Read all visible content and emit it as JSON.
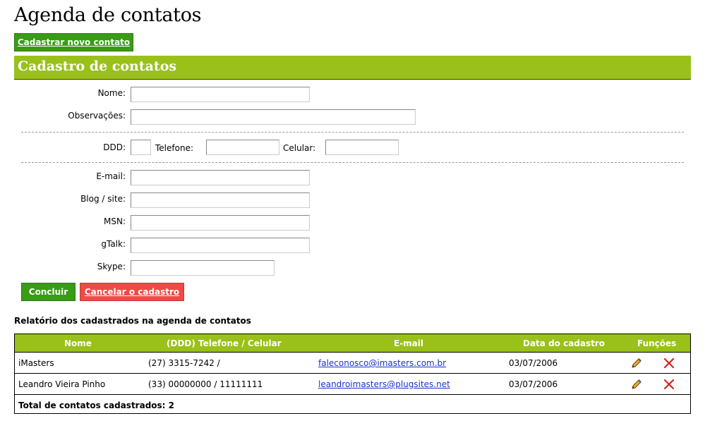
{
  "page": {
    "title": "Agenda de contatos"
  },
  "toolbar": {
    "new_contact_label": "Cadastrar novo contato"
  },
  "form": {
    "section_title": "Cadastro de contatos",
    "fields": {
      "nome": {
        "label": "Nome:",
        "value": ""
      },
      "observacoes": {
        "label": "Observações:",
        "value": ""
      },
      "ddd": {
        "label": "DDD:",
        "value": ""
      },
      "telefone": {
        "label": "Telefone:",
        "value": ""
      },
      "celular": {
        "label": "Celular:",
        "value": ""
      },
      "email": {
        "label": "E-mail:",
        "value": ""
      },
      "blog": {
        "label": "Blog / site:",
        "value": ""
      },
      "msn": {
        "label": "MSN:",
        "value": ""
      },
      "gtalk": {
        "label": "gTalk:",
        "value": ""
      },
      "skype": {
        "label": "Skype:",
        "value": ""
      }
    },
    "submit_label": "Concluir",
    "cancel_label": "Cancelar o cadastro"
  },
  "report": {
    "title": "Relatório dos cadastrados na agenda de contatos",
    "columns": [
      "Nome",
      "(DDD) Telefone / Celular",
      "E-mail",
      "Data do cadastro",
      "Funções"
    ],
    "rows": [
      {
        "nome": "iMasters",
        "telefone": "(27) 3315-7242 /",
        "email": "faleconosco@imasters.com.br",
        "data": "03/07/2006"
      },
      {
        "nome": "Leandro Vieira Pinho",
        "telefone": "(33) 00000000 / 11111111",
        "email": "leandroimasters@plugsites.net",
        "data": "03/07/2006"
      }
    ],
    "total_label": "Total de contatos cadastrados: 2",
    "row_actions": [
      "pencil-icon",
      "delete-x-icon"
    ]
  },
  "colors": {
    "accent_green": "#99c11a",
    "button_green": "#3a9b16",
    "button_red": "#f04a45",
    "link_blue": "#1a33cc"
  }
}
